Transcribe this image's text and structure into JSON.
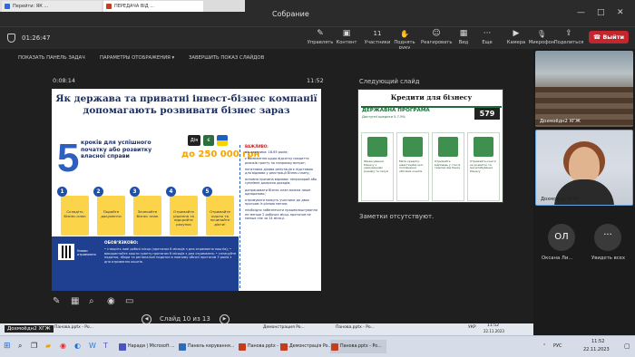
{
  "browser": {
    "tabs": [
      "Перейти: ЯК ...",
      "ПЕРЕДАЧА ВІД ...",
      "Collapse tab"
    ]
  },
  "window": {
    "title": "Собрание",
    "controls": [
      "—",
      "□",
      "✕"
    ]
  },
  "meeting": {
    "timer": "01:26:47",
    "toolbar": [
      {
        "icon": "edit-icon",
        "glyph": "✎",
        "label": "Управлять"
      },
      {
        "icon": "content-icon",
        "glyph": "▣",
        "label": "Контент"
      },
      {
        "icon": "participants-icon",
        "glyph": "👥",
        "label": "Участники",
        "count": "11"
      },
      {
        "icon": "raise-hand-icon",
        "glyph": "✋",
        "label": "Поднять руку"
      },
      {
        "icon": "react-icon",
        "glyph": "☺",
        "label": "Реагировать"
      },
      {
        "icon": "view-icon",
        "glyph": "▦",
        "label": "Вид"
      },
      {
        "icon": "more-icon",
        "glyph": "···",
        "label": "Еще"
      },
      {
        "icon": "camera-icon",
        "glyph": "▶",
        "label": "Камера"
      },
      {
        "icon": "mic-icon",
        "glyph": "🎙",
        "label": "Микрофон"
      },
      {
        "icon": "share-icon",
        "glyph": "⇪",
        "label": "Поделиться"
      }
    ],
    "exit_label": "Выйти"
  },
  "presenter": {
    "toolbar": [
      "ПОКАЗАТЬ ПАНЕЛЬ ЗАДАЧ",
      "ПАРАМЕТРЫ ОТОБРАЖЕНИЯ ▾",
      "ЗАВЕРШИТЬ ПОКАЗ СЛАЙДОВ"
    ],
    "elapsed": "0:08:14",
    "clock": "11:52",
    "next_slide_label": "Следующий слайд",
    "notes": "Заметки отсутствуют.",
    "nav_label": "Слайд 10 из 13"
  },
  "slide": {
    "title": "Як держава та приватні інвест-бізнес компанії допомагають розвивати бізнес зараз",
    "big_number": "5",
    "steps_text": "кроків для успішного початку або розвитку власної справи",
    "amount": "до 250 000 грн",
    "steps": [
      {
        "num": "1",
        "label": "Складіть бізнес-план"
      },
      {
        "num": "2",
        "label": "Подайте документи"
      },
      {
        "num": "3",
        "label": "Зачекайте бізнес план"
      },
      {
        "num": "4",
        "label": "Отримайте рішення та відкрийте рахунок"
      },
      {
        "num": "5",
        "label": "Отримайте кошти та починайте діяти!"
      }
    ],
    "rules_head": "ВАЖЛИВО:",
    "rules": [
      "вік заявника: 18-65 років;",
      "є обмеження щодо відсотку покриття ризиків гранту по напрямку витрат;",
      "негативна ділова репутація є підставою для відмови у реєстрації бізнес-плану;",
      "основна причина відмови: непрозорий або сумнівне джерело доходів;",
      "допрацювати бізнес-план можна лише одноразово;",
      "отримувати можуть учасники до двох програм із різною метою;",
      "необхідно забезпечити працевлаштування не менше 2 робочих місць протягом не менше ніж за 24 місяці."
    ],
    "qr_caption": "Умови отримання",
    "must_title": "ОБОВ'ЯЗКОВО:",
    "must_list": "• створіть нові робочі місця (протягом 6 місяців з дня отримання коштів); • використайте кошти гранту протягом 6 місяців з дня отримання; • сплачуйте податки, збори та регіональні податки в повному обсязі протягом 3 років з дня отримання коштів."
  },
  "next_slide": {
    "title": "Кредити для бізнесу",
    "program": "ДЕРЖАВНА ПРОГРАМА",
    "program_sub": "Доступні кредити 5-7-9%",
    "code": "579",
    "cards": [
      "Фінансування бізнесу з урахуванням розміру та галузі",
      "Мета кредиту: інвестиційні цілі, поповнення обігових коштів",
      "Отримайте відповідь у стислі терміни від банку",
      "Отримайте кошти на розвиток та масштабування бізнесу"
    ]
  },
  "participants": [
    {
      "name": "Дохмоёдн2 ХГЖ"
    },
    {
      "name": "Дохмоёдн ХГЖ"
    }
  ],
  "avatars": [
    {
      "initials": "ОЛ",
      "caption": "Оксана Ли..."
    },
    {
      "initials": "···",
      "caption": "Увидеть всех"
    }
  ],
  "taskbar": {
    "apps": [
      {
        "label": "Наради | Microsoft ...",
        "color": "#4b53bc"
      },
      {
        "label": "Панель керування...",
        "color": "#2f6cb5"
      },
      {
        "label": "Панова.pptx - Po...",
        "color": "#c43e1c"
      },
      {
        "label": "Демонстрація Po...",
        "color": "#c43e1c"
      },
      {
        "label": "Панова.pptx - Po...",
        "color": "#c43e1c"
      }
    ],
    "tray_lang": "РУС",
    "time": "11:52",
    "date": "22.11.2023"
  },
  "inner_taskbar": {
    "apps": [
      "Дохмоёдн2 ХГЖ",
      "Панова.pptx - Po...",
      "Демонстрация Po...",
      "Панова.pptx - Po..."
    ],
    "time": "11:52",
    "date": "22.11.2023",
    "lang": "УКР"
  }
}
